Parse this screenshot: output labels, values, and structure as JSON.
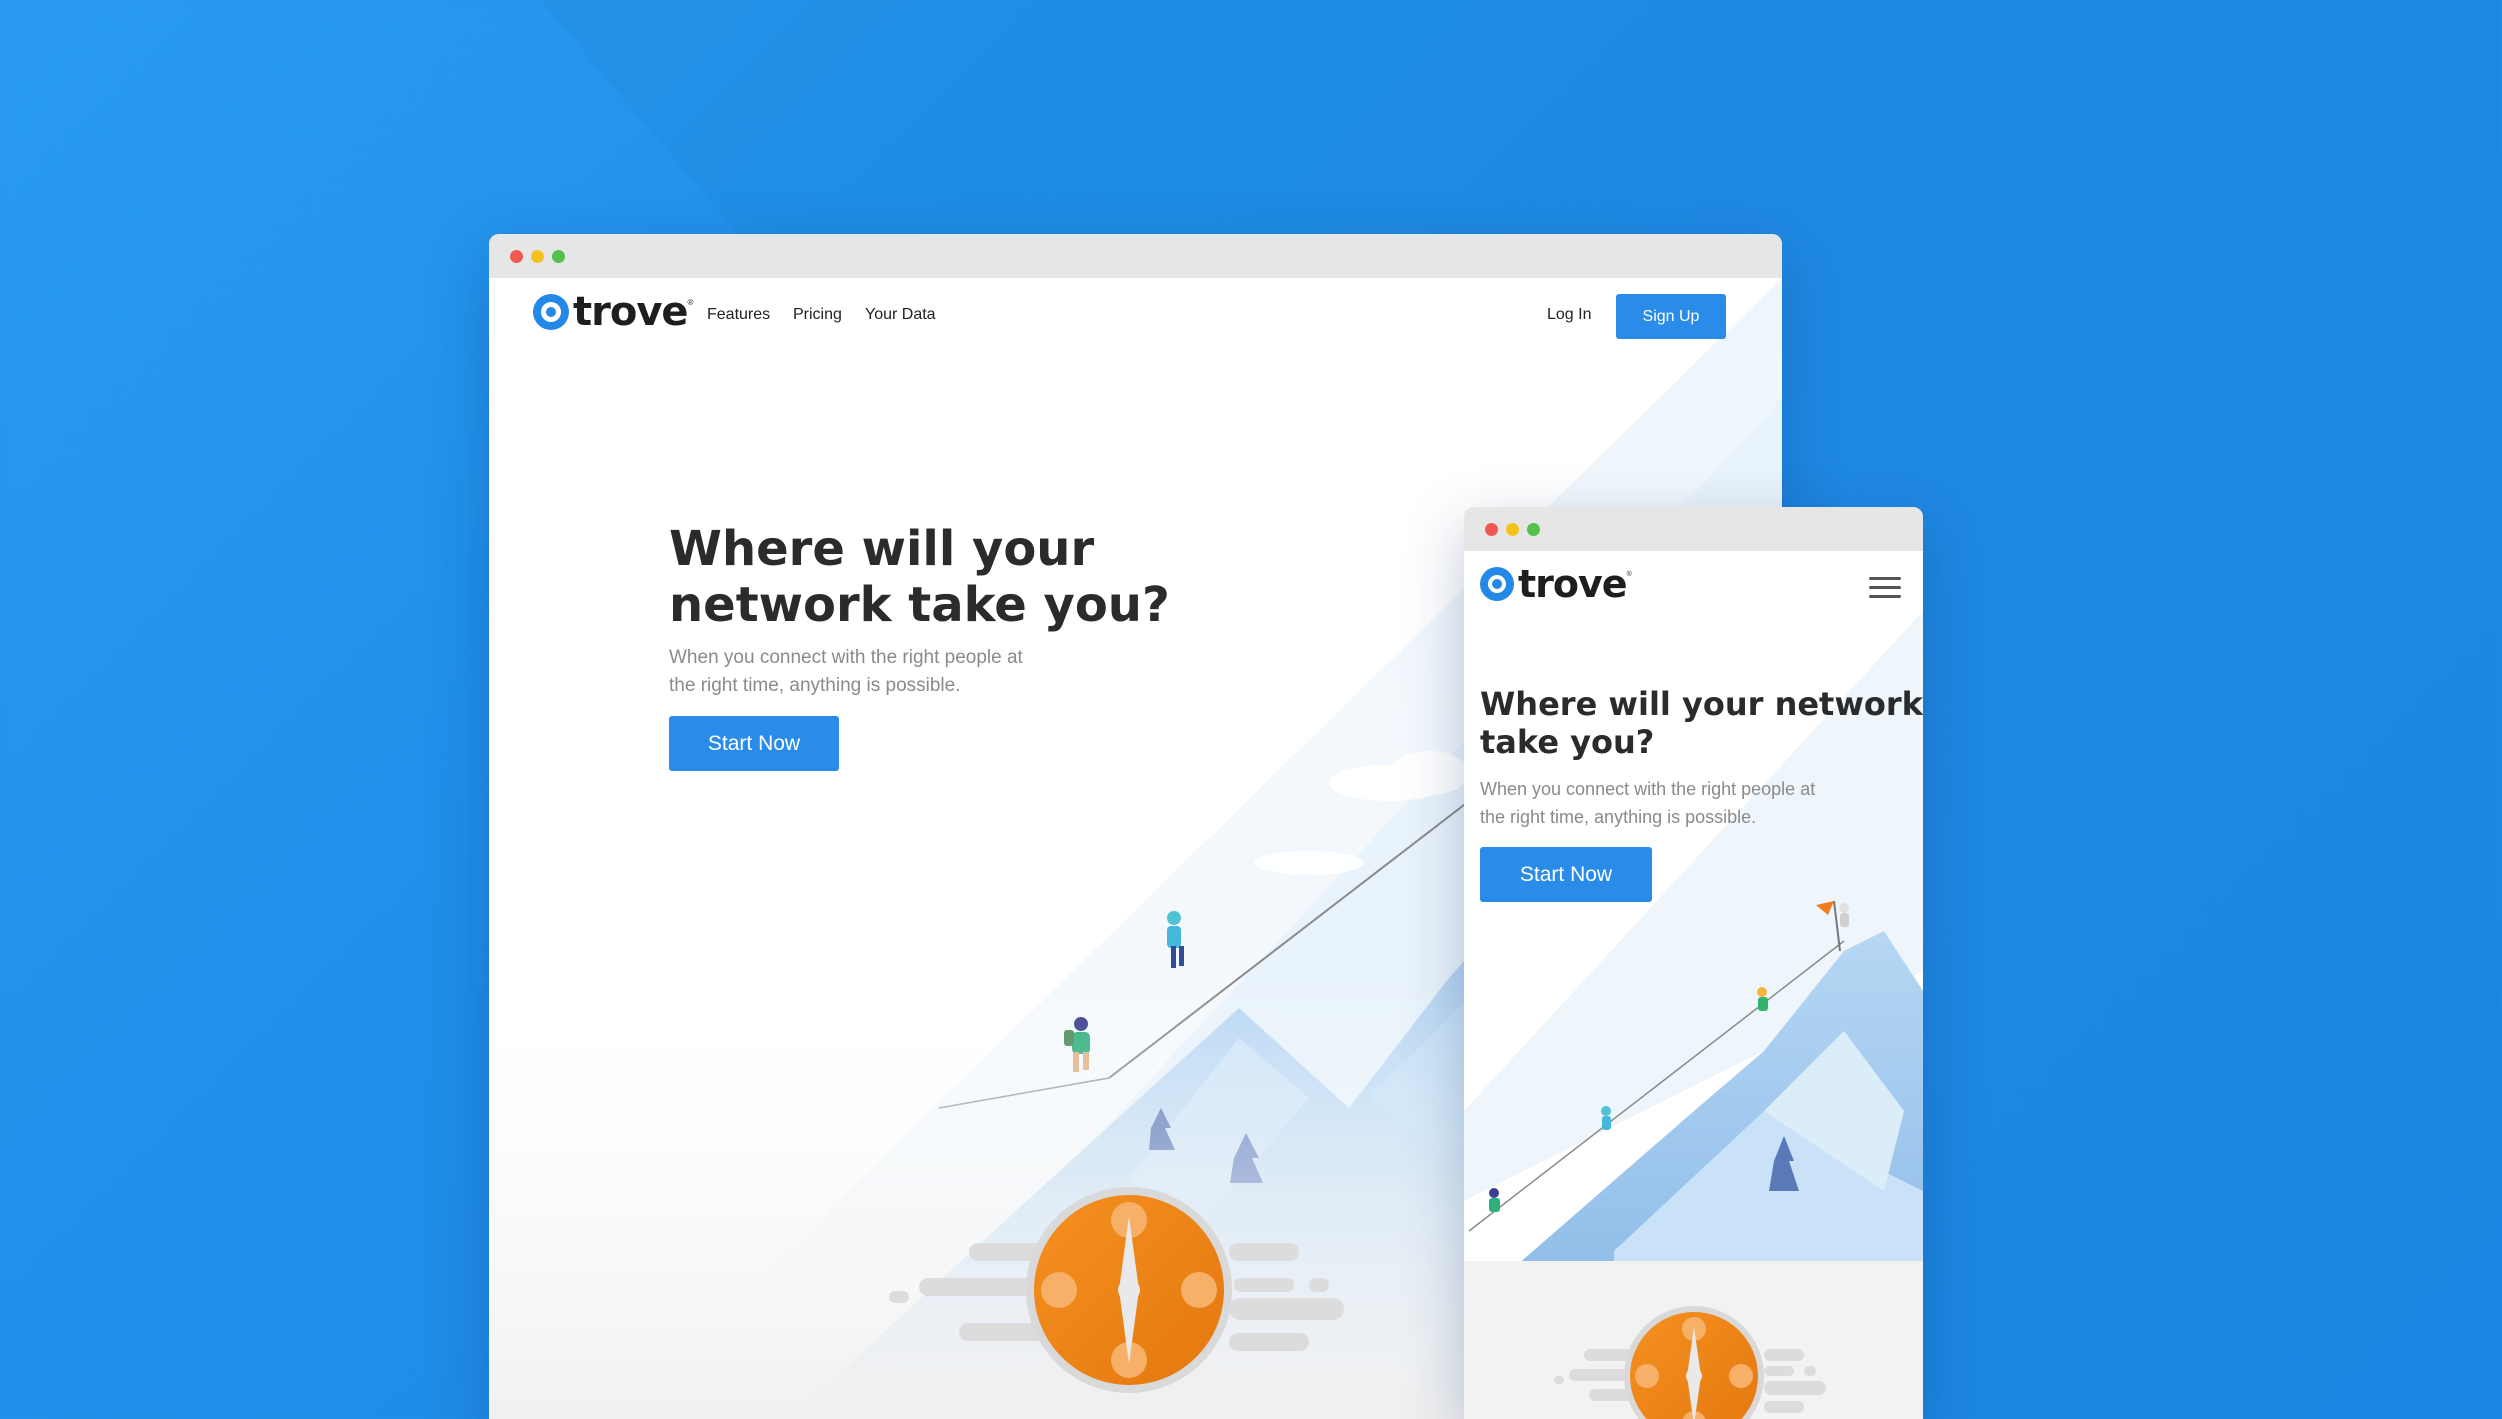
{
  "colors": {
    "background": "#2090ea",
    "brand_blue": "#2a8ce8",
    "titlebar": "#e6e6e6",
    "dot_red": "#ee5a52",
    "dot_yellow": "#f4c21f",
    "dot_green": "#52c24a",
    "badge_orange": "#f0861c"
  },
  "desktop": {
    "logo": {
      "text": "trove",
      "tm": "®"
    },
    "nav": [
      {
        "label": "Features"
      },
      {
        "label": "Pricing"
      },
      {
        "label": "Your Data"
      }
    ],
    "login_label": "Log In",
    "signup_label": "Sign Up",
    "hero": {
      "title_line1": "Where will your",
      "title_line2": "network take you?",
      "subtitle_line1": "When you connect with the right people at",
      "subtitle_line2": "the right time, anything is possible.",
      "cta_label": "Start Now"
    }
  },
  "mobile": {
    "logo": {
      "text": "trove",
      "tm": "®"
    },
    "menu_icon": "hamburger-icon",
    "hero": {
      "title_line1": "Where will your network",
      "title_line2": "take you?",
      "subtitle_line1": "When you connect with the right people at",
      "subtitle_line2": "the right time, anything is possible.",
      "cta_label": "Start Now"
    }
  },
  "illustration": {
    "scene": "mountain-climbers-illustration",
    "badge": "network-compass-icon"
  }
}
